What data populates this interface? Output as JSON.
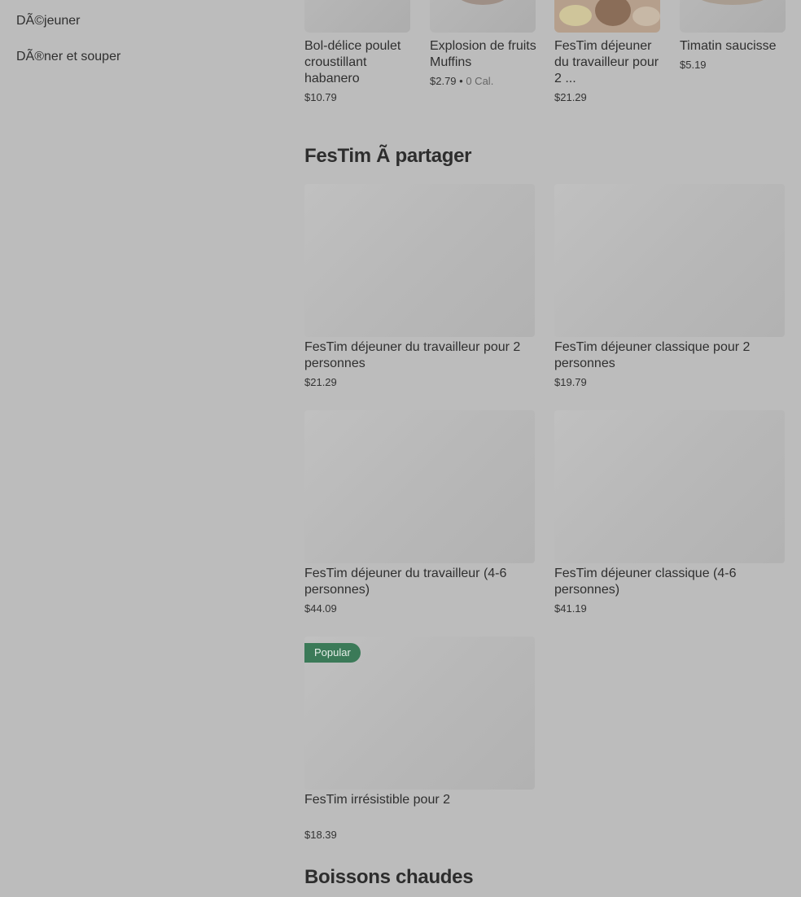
{
  "sidebar": {
    "items": [
      {
        "label": "DÃ©jeuner"
      },
      {
        "label": "DÃ®ner et souper"
      }
    ]
  },
  "top_row": [
    {
      "title": "Bol-délice poulet croustillant habanero",
      "price": "$10.79",
      "calories": ""
    },
    {
      "title": "Explosion de fruits Muffins",
      "price": "$2.79",
      "calories": "0 Cal."
    },
    {
      "title": "FesTim déjeuner du travailleur pour 2 ...",
      "price": "$21.29",
      "calories": ""
    },
    {
      "title": "Timatin saucisse",
      "price": "$5.19",
      "calories": ""
    }
  ],
  "section_share": {
    "title": "FesTim Ã  partager",
    "items": [
      {
        "title": "FesTim déjeuner du travailleur pour 2 personnes",
        "price": "$21.29"
      },
      {
        "title": "FesTim déjeuner classique pour 2 personnes",
        "price": "$19.79"
      },
      {
        "title": "FesTim déjeuner du travailleur (4-6 personnes)",
        "price": "$44.09"
      },
      {
        "title": "FesTim déjeuner classique (4-6 personnes)",
        "price": "$41.19"
      },
      {
        "title": "FesTim irrésistible pour 2",
        "price": "$18.39",
        "badge": "Popular"
      }
    ]
  },
  "section_hot": {
    "title": "Boissons chaudes"
  }
}
